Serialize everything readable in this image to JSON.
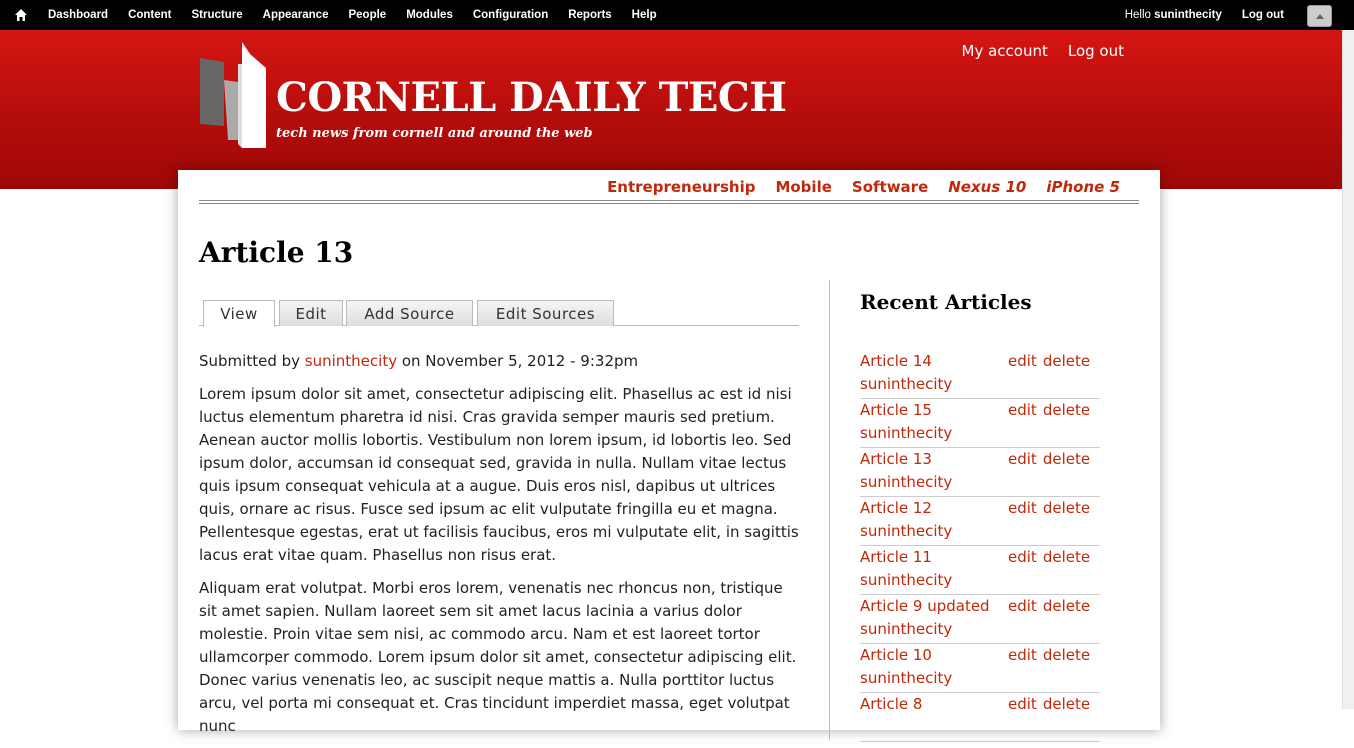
{
  "toolbar": {
    "items": [
      "Dashboard",
      "Content",
      "Structure",
      "Appearance",
      "People",
      "Modules",
      "Configuration",
      "Reports",
      "Help"
    ],
    "hello_prefix": "Hello ",
    "username": "suninthecity",
    "logout": "Log out"
  },
  "header": {
    "site_name": "CORNELL DAILY TECH",
    "slogan": "tech news from cornell and around the web",
    "secondary_menu": [
      "My account",
      "Log out"
    ]
  },
  "main_menu": [
    {
      "label": "Entrepreneurship",
      "italic": false
    },
    {
      "label": "Mobile",
      "italic": false
    },
    {
      "label": "Software",
      "italic": false
    },
    {
      "label": "Nexus 10",
      "italic": true
    },
    {
      "label": "iPhone 5",
      "italic": true
    }
  ],
  "article": {
    "title": "Article 13",
    "tabs": [
      "View",
      "Edit",
      "Add Source",
      "Edit Sources"
    ],
    "submitted_prefix": "Submitted by ",
    "author": "suninthecity",
    "submitted_suffix": " on November 5, 2012 - 9:32pm",
    "paragraphs": [
      "Lorem ipsum dolor sit amet, consectetur adipiscing elit. Phasellus ac est id nisi luctus elementum pharetra id nisi. Cras gravida semper mauris sed pretium. Aenean auctor mollis lobortis. Vestibulum non lorem ipsum, id lobortis leo. Sed ipsum dolor, accumsan id consequat sed, gravida in nulla. Nullam vitae lectus quis ipsum consequat vehicula at a augue. Duis eros nisl, dapibus ut ultrices quis, ornare ac risus. Fusce sed ipsum ac elit vulputate fringilla eu et magna. Pellentesque egestas, erat ut facilisis faucibus, eros mi vulputate elit, in sagittis lacus erat vitae quam. Phasellus non risus erat.",
      "Aliquam erat volutpat. Morbi eros lorem, venenatis nec rhoncus non, tristique sit amet sapien. Nullam laoreet sem sit amet lacus lacinia a varius dolor molestie. Proin vitae sem nisi, ac commodo arcu. Nam et est laoreet tortor ullamcorper commodo. Lorem ipsum dolor sit amet, consectetur adipiscing elit. Donec varius venenatis leo, ac suscipit neque mattis a. Nulla porttitor luctus arcu, vel porta mi consequat et. Cras tincidunt imperdiet massa, eget volutpat nunc"
    ]
  },
  "sidebar": {
    "title": "Recent Articles",
    "edit_label": "edit",
    "delete_label": "delete",
    "articles": [
      {
        "title": "Article 14",
        "author": "suninthecity"
      },
      {
        "title": "Article 15",
        "author": "suninthecity"
      },
      {
        "title": "Article 13",
        "author": "suninthecity"
      },
      {
        "title": "Article 12",
        "author": "suninthecity"
      },
      {
        "title": "Article 11",
        "author": "suninthecity"
      },
      {
        "title": "Article 9 updated",
        "author": "suninthecity"
      },
      {
        "title": "Article 10",
        "author": "suninthecity"
      },
      {
        "title": "Article 8",
        "author": ""
      }
    ]
  },
  "colors": {
    "header_red": "#c0100e",
    "link": "#c1280b"
  }
}
